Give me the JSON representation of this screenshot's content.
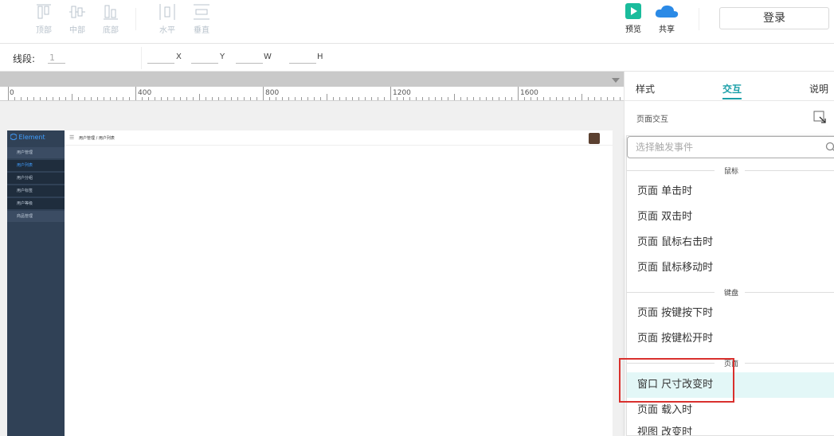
{
  "toolbar": {
    "align_buttons": [
      {
        "label": "顶部",
        "icon": "align-top-icon"
      },
      {
        "label": "中部",
        "icon": "align-middle-icon"
      },
      {
        "label": "底部",
        "icon": "align-bottom-icon"
      },
      {
        "label": "水平",
        "icon": "distribute-horizontal-icon"
      },
      {
        "label": "垂直",
        "icon": "distribute-vertical-icon"
      }
    ],
    "preview_label": "预览",
    "share_label": "共享",
    "login_label": "登录",
    "colors": {
      "preview": "#1abc9c",
      "share": "#2b8ae6"
    }
  },
  "propbar": {
    "segment_label": "线段:",
    "segment_value": "1",
    "x_label": "X",
    "y_label": "Y",
    "w_label": "W",
    "h_label": "H"
  },
  "ruler": {
    "labels": [
      "0",
      "400",
      "800",
      "1200",
      "1600"
    ]
  },
  "mock_page": {
    "logo": "Element",
    "menu": [
      "用户管理",
      "用户列表",
      "用户分组",
      "用户标签",
      "用户等级",
      "商品管理"
    ],
    "breadcrumb": "用户管理 / 用户列表"
  },
  "panel": {
    "tabs": [
      "样式",
      "交互",
      "说明"
    ],
    "active_tab": "交互",
    "subtitle": "页面交互",
    "search_placeholder": "选择触发事件",
    "groups": [
      {
        "title": "鼠标",
        "items": [
          "页面 单击时",
          "页面 双击时",
          "页面 鼠标右击时",
          "页面 鼠标移动时"
        ]
      },
      {
        "title": "键盘",
        "items": [
          "页面 按键按下时",
          "页面 按键松开时"
        ]
      },
      {
        "title": "页面",
        "items": [
          "窗口 尺寸改变时",
          "页面 载入时",
          "视图 改变时"
        ]
      }
    ],
    "highlighted_item": "窗口 尺寸改变时",
    "accent_color": "#1a9fa8",
    "highlight_color": "#e3f7f7",
    "annotation_color": "#d9302d"
  }
}
